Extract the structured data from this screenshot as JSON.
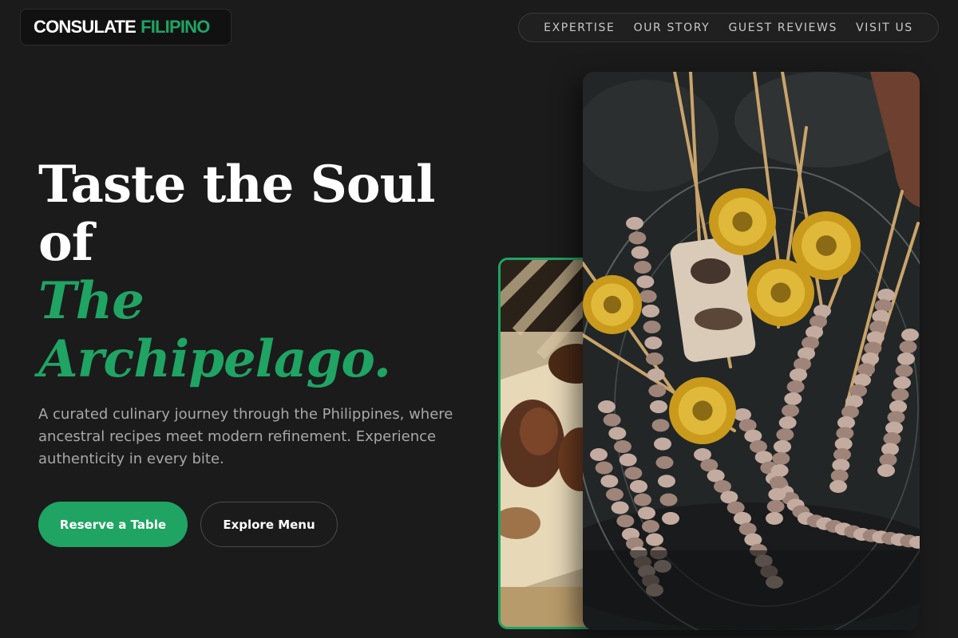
{
  "brand": {
    "name": "CONSULATE",
    "accent": "FILIPINO",
    "accent_color": "#1fa463"
  },
  "nav": {
    "items": [
      {
        "label": "EXPERTISE"
      },
      {
        "label": "OUR STORY"
      },
      {
        "label": "GUEST REVIEWS"
      },
      {
        "label": "VISIT US"
      }
    ]
  },
  "hero": {
    "headline_line1": "Taste the Soul",
    "headline_line2": "of",
    "headline_accent_line1": "The",
    "headline_accent_line2": "Archipelago.",
    "lead": "A curated culinary journey through the Philippines, where ancestral recipes meet modern refinement. Experience authenticity in every bite.",
    "primary_button": "Reserve a Table",
    "secondary_button": "Explore Menu"
  },
  "images": {
    "back_photo": "grilled-chicken-on-banana-leaf-photo",
    "main_photo": "isaw-skewers-on-grill-photo"
  },
  "colors": {
    "background": "#1b1b1b",
    "accent": "#1fa463",
    "text": "#ffffff",
    "muted": "#a8a8a8"
  }
}
